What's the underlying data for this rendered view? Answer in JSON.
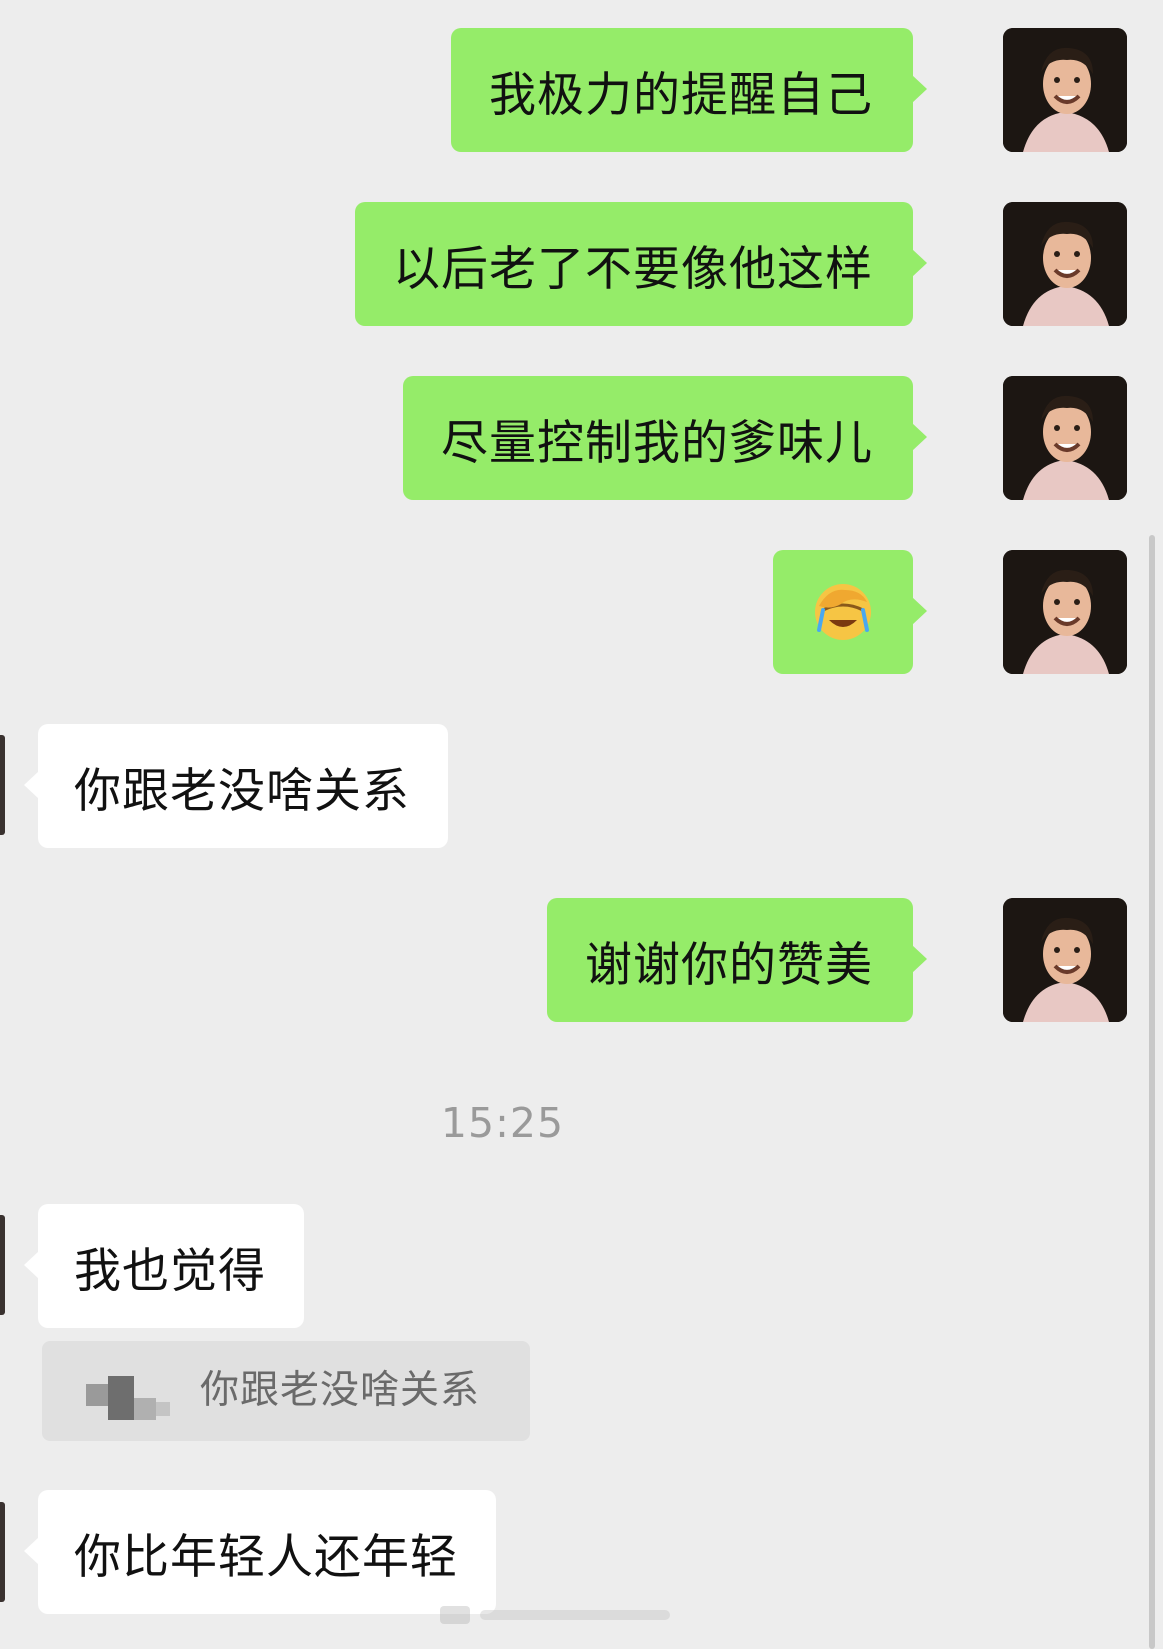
{
  "messages": [
    {
      "direction": "out",
      "text": "我极力的提醒自己"
    },
    {
      "direction": "out",
      "text": "以后老了不要像他这样"
    },
    {
      "direction": "out",
      "text": "尽量控制我的爹味儿"
    },
    {
      "direction": "out",
      "emoji": "face-palm-crying-emoji"
    },
    {
      "direction": "in",
      "text": "你跟老没啥关系"
    },
    {
      "direction": "out",
      "text": "谢谢你的赞美"
    },
    {
      "direction": "in",
      "text": "我也觉得"
    },
    {
      "direction": "in",
      "text": "你比年轻人还年轻"
    }
  ],
  "timestamp": "15:25",
  "quote": {
    "text": "你跟老没啥关系"
  },
  "colors": {
    "background": "#ededed",
    "outgoing_bubble": "#95ec69",
    "incoming_bubble": "#ffffff",
    "timestamp_text": "#9a9a9a",
    "quote_background": "#e0e0e0"
  }
}
